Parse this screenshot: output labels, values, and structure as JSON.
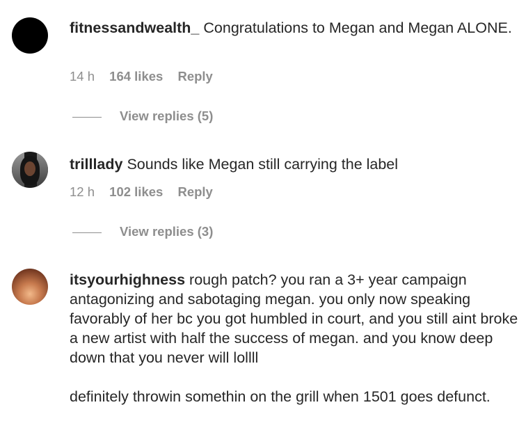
{
  "comments": [
    {
      "username": "fitnessandwealth_",
      "text": "Congratulations to Megan and Megan ALONE.",
      "time": "14 h",
      "likes": "164 likes",
      "reply": "Reply",
      "view_replies": "View replies (5)"
    },
    {
      "username": "trilllady",
      "text": "Sounds like Megan still carrying the label",
      "time": "12 h",
      "likes": "102 likes",
      "reply": "Reply",
      "view_replies": "View replies (3)"
    },
    {
      "username": "itsyourhighness",
      "text": "rough patch? you ran a 3+ year campaign antagonizing and sabotaging megan. you only now speaking favorably of her bc you got humbled in court, and you still aint broke a new artist with half the success of megan. and you know deep down that you never will lollll",
      "text2": "definitely throwin somethin on the grill when 1501 goes defunct."
    }
  ]
}
